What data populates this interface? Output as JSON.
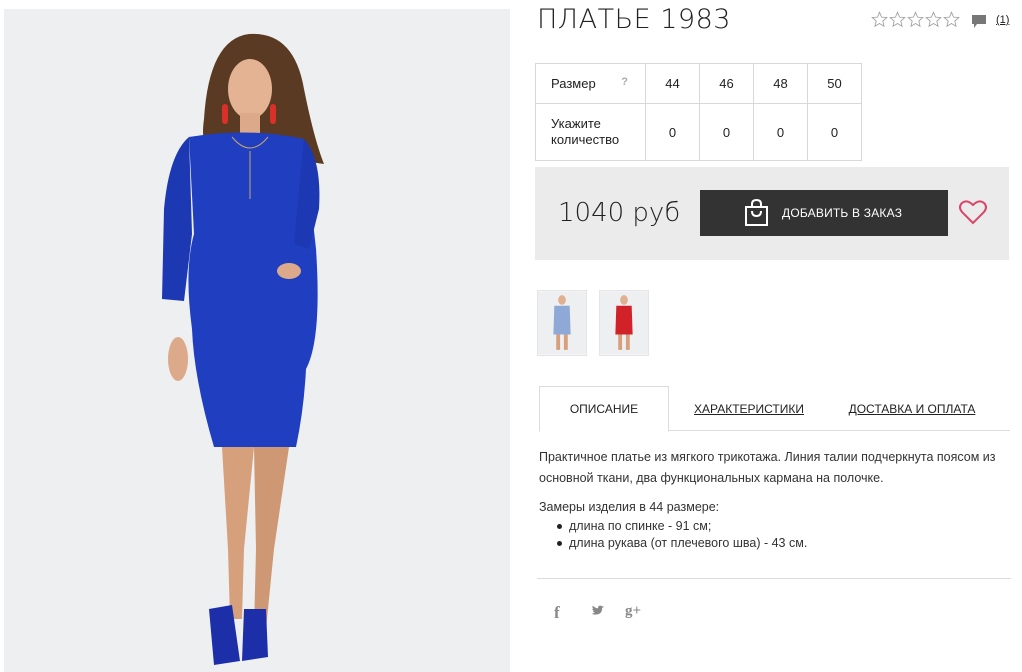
{
  "product": {
    "title": "ПЛАТЬЕ 1983",
    "rating_stars": 5,
    "rating_value": 0,
    "reviews_count": "(1)",
    "photo_dress_color": "#1f3fc0",
    "thumb_colors": [
      "#8fa9d6",
      "#d1222a"
    ]
  },
  "size_table": {
    "size_label": "Размер",
    "help_mark": "?",
    "quantity_label": "Укажите количество",
    "sizes": [
      "44",
      "46",
      "48",
      "50"
    ],
    "quantities": [
      "0",
      "0",
      "0",
      "0"
    ]
  },
  "purchase": {
    "price": "1040 руб",
    "add_button_label": "ДОБАВИТЬ В ЗАКАЗ",
    "button_color": "#333333",
    "heart_color": "#d9476b"
  },
  "tabs": [
    {
      "label": "ОПИСАНИЕ",
      "active": true
    },
    {
      "label": "ХАРАКТЕРИСТИКИ",
      "active": false
    },
    {
      "label": "ДОСТАВКА И ОПЛАТА",
      "active": false
    }
  ],
  "description": {
    "text": "Практичное платье из мягкого трикотажа. Линия талии подчеркнута поясом из основной ткани, два функциональных кармана на полочке.",
    "measurements_title": "Замеры изделия в 44 размере:",
    "measurements": [
      "длина по спинке - 91 см;",
      "длина рукава (от плечевого шва) - 43 см."
    ]
  },
  "social": {
    "facebook": "f",
    "twitter": "twitter-bird-icon",
    "googleplus": "g+"
  }
}
